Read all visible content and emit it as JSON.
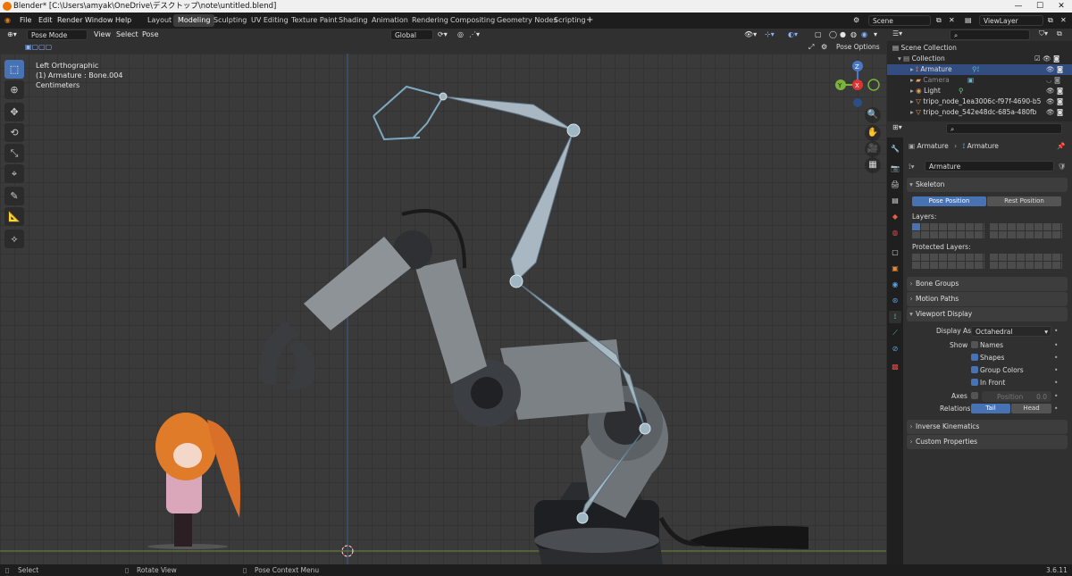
{
  "window": {
    "title": "Blender* [C:\\Users\\amyak\\OneDrive\\デスクトップ\\note\\untitled.blend]"
  },
  "menu": [
    "File",
    "Edit",
    "Render",
    "Window",
    "Help"
  ],
  "workspaces": [
    "Layout",
    "Modeling",
    "Sculpting",
    "UV Editing",
    "Texture Paint",
    "Shading",
    "Animation",
    "Rendering",
    "Compositing",
    "Geometry Nodes",
    "Scripting"
  ],
  "active_workspace": "Modeling",
  "scene": "Scene",
  "view_layer": "ViewLayer",
  "viewport_header": {
    "mode": "Pose Mode",
    "menus": [
      "View",
      "Select",
      "Pose"
    ],
    "transform": "Global"
  },
  "tool_options": "Pose Options",
  "viewport_info": {
    "line1": "Left Orthographic",
    "line2": "(1) Armature : Bone.004",
    "line3": "Centimeters"
  },
  "gizmo": {
    "z": "Z",
    "y": "Y",
    "x": "X"
  },
  "outliner": {
    "rows": [
      "Scene Collection",
      "Collection",
      "Armature",
      "Camera",
      "Light",
      "tripo_node_1ea3006c-f97f-4690-b5",
      "tripo_node_542e48dc-685a-480fb"
    ]
  },
  "properties": {
    "breadcrumb": [
      "Armature",
      "Armature"
    ],
    "data_name": "Armature",
    "skeleton": {
      "title": "Skeleton",
      "pose_position": "Pose Position",
      "rest_position": "Rest Position",
      "layers_label": "Layers:",
      "protected_label": "Protected Layers:"
    },
    "bone_groups": "Bone Groups",
    "motion_paths": "Motion Paths",
    "viewport_display": {
      "title": "Viewport Display",
      "display_as_label": "Display As",
      "display_as": "Octahedral",
      "show_label": "Show",
      "names": "Names",
      "shapes": "Shapes",
      "group_colors": "Group Colors",
      "in_front": "In Front",
      "axes_label": "Axes",
      "position": "Position",
      "position_value": "0.0",
      "relations_label": "Relations",
      "tail": "Tail",
      "head": "Head"
    },
    "inverse_kinematics": "Inverse Kinematics",
    "custom_properties": "Custom Properties"
  },
  "status": {
    "select": "Select",
    "rotate": "Rotate View",
    "context": "Pose Context Menu",
    "version": "3.6.11"
  },
  "colors": {
    "accent": "#4772b3",
    "bone": "#a9b7c2",
    "selected_row": "#334d80"
  }
}
